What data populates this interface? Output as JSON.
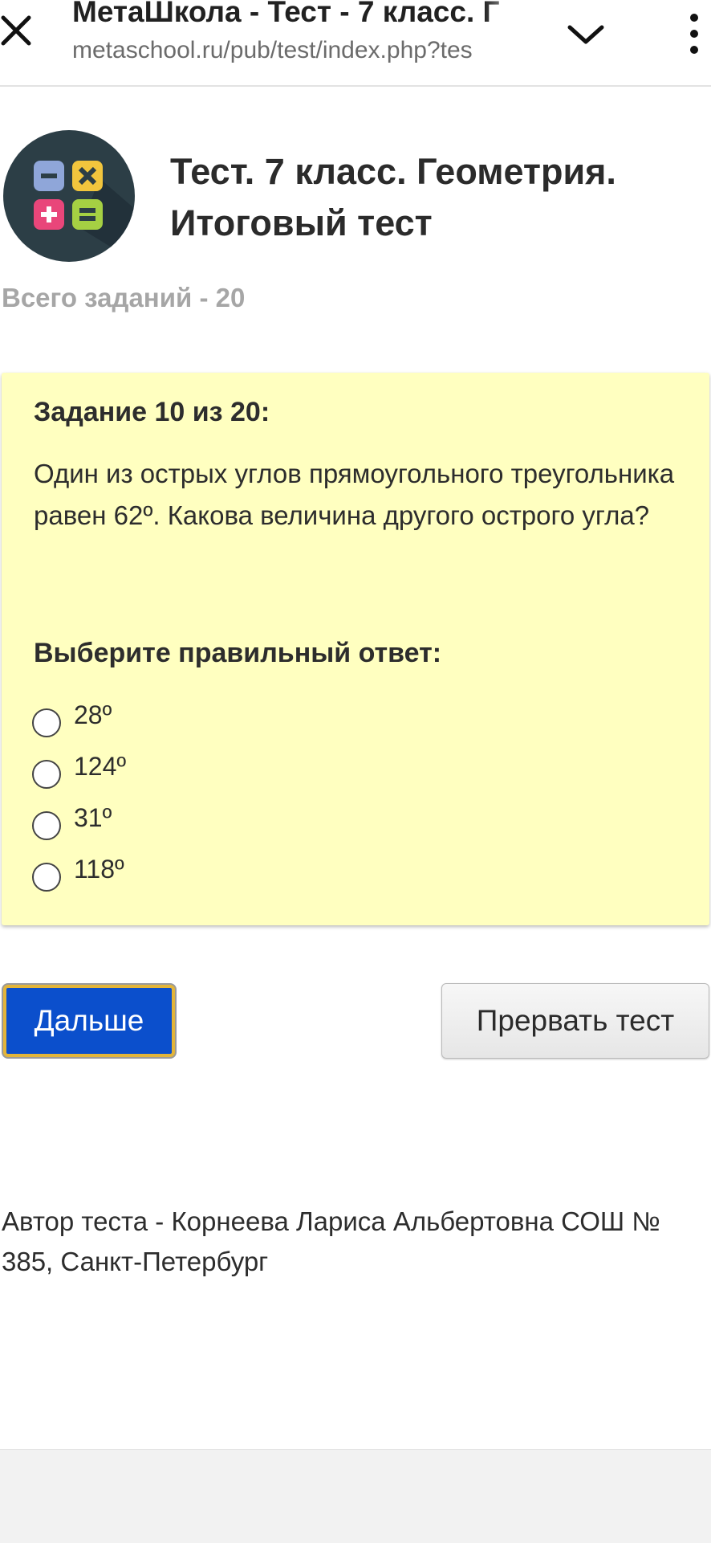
{
  "browser": {
    "tab_title": "МетаШкола - Тест - 7 класс. Г",
    "url": "metaschool.ru/pub/test/index.php?tes",
    "icons": [
      "close-icon",
      "chevron-down-icon",
      "more-vert-icon"
    ]
  },
  "header": {
    "logo": {
      "icon": "calculator-icon",
      "colors": {
        "circle": "#2c3e46",
        "minus": "#8fa6d9",
        "times": "#f2c53d",
        "plus": "#e9467a",
        "equals": "#a5d043"
      }
    },
    "title_line1": "Тест. 7 класс. Геометрия.",
    "title_line2": "Итоговый тест"
  },
  "task_total": "Всего заданий - 20",
  "question": {
    "number_label": "Задание 10 из 20:",
    "text": "Один из острых углов прямоугольного треугольника равен 62º. Какова величина другого острого угла?",
    "prompt": "Выберите правильный ответ:",
    "options": [
      {
        "label": "28º",
        "selected": false
      },
      {
        "label": "124º",
        "selected": false
      },
      {
        "label": "31º",
        "selected": false
      },
      {
        "label": "118º",
        "selected": false
      }
    ],
    "card_color": "#ffffc0"
  },
  "buttons": {
    "next": "Дальше",
    "abort": "Прервать тест",
    "next_color": "#0b4fcc",
    "next_border_color": "#e3b53a"
  },
  "footer": {
    "author": "Автор теста - Корнеева Лариса Альбертовна СОШ № 385, Санкт-Петербург"
  }
}
